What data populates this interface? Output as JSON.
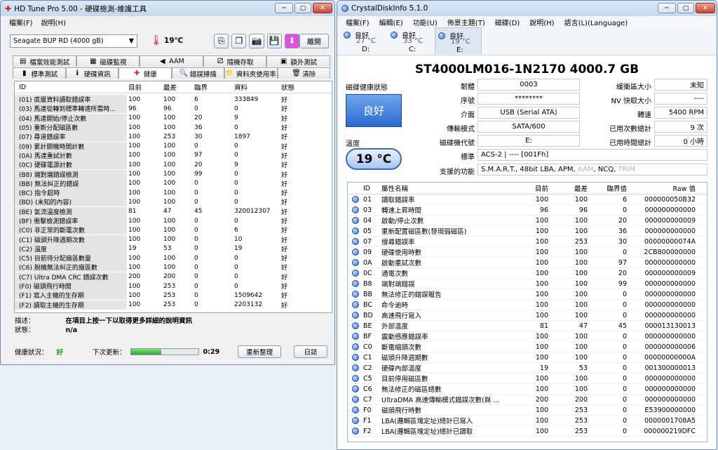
{
  "hdtune": {
    "title": "HD Tune Pro  5.00 - 硬碟檢測-維護工具",
    "menu": [
      "檔案(F)",
      "說明(H)"
    ],
    "drive": "Seagate BUP RD          (4000 gB)",
    "temp": "19℃",
    "exit_label": "離開",
    "tabs_top": [
      {
        "label": "檔案效能測試",
        "icon": "files-icon"
      },
      {
        "label": "磁碟監視",
        "icon": "monitor-icon"
      },
      {
        "label": "AAM",
        "icon": "speaker-icon"
      },
      {
        "label": "隨機存取",
        "icon": "dice-icon"
      },
      {
        "label": "額外測試",
        "icon": "extra-icon"
      }
    ],
    "tabs_bottom": [
      {
        "label": "標準測試",
        "icon": "benchmark-icon"
      },
      {
        "label": "硬碟資訊",
        "icon": "info-icon"
      },
      {
        "label": "健康",
        "icon": "health-cross-icon"
      },
      {
        "label": "錯誤掃描",
        "icon": "magnifier-icon"
      },
      {
        "label": "資料夾使用率",
        "icon": "folder-icon"
      },
      {
        "label": "清除",
        "icon": "trash-icon"
      }
    ],
    "columns": [
      "ID",
      "目前",
      "最差",
      "臨界",
      "資料",
      "狀態"
    ],
    "rows": [
      [
        "(01) 底層資料讀取錯誤率",
        "100",
        "100",
        "6",
        "333849",
        "好"
      ],
      [
        "(03) 馬達從轉到標準轉速所需時...",
        "96",
        "96",
        "0",
        "0",
        "好"
      ],
      [
        "(04) 馬達開始/停止次數",
        "100",
        "100",
        "20",
        "9",
        "好"
      ],
      [
        "(05) 重新分配磁區數",
        "100",
        "100",
        "36",
        "0",
        "好"
      ],
      [
        "(07) 尋道錯誤率",
        "100",
        "253",
        "30",
        "1897",
        "好"
      ],
      [
        "(09) 累計開機時間計數",
        "100",
        "100",
        "0",
        "0",
        "好"
      ],
      [
        "(0A) 馬達重試計數",
        "100",
        "100",
        "97",
        "0",
        "好"
      ],
      [
        "(0C) 硬碟電源計數",
        "100",
        "100",
        "20",
        "9",
        "好"
      ],
      [
        "(B8) 端對端錯誤檢測",
        "100",
        "100",
        "99",
        "0",
        "好"
      ],
      [
        "(BB) 無法糾正的錯誤",
        "100",
        "100",
        "0",
        "0",
        "好"
      ],
      [
        "(BC) 指令超時",
        "100",
        "100",
        "0",
        "0",
        "好"
      ],
      [
        "(BD) (未知的內容)",
        "100",
        "100",
        "0",
        "0",
        "好"
      ],
      [
        "(BE) 氣流溫度檢測",
        "81",
        "47",
        "45",
        "320012307",
        "好"
      ],
      [
        "(BF) 衝擊檢測錯誤率",
        "100",
        "100",
        "0",
        "0",
        "好"
      ],
      [
        "(C0) 非正常的斷電次數",
        "100",
        "100",
        "0",
        "6",
        "好"
      ],
      [
        "(C1) 磁頭升降週期次數",
        "100",
        "100",
        "0",
        "10",
        "好"
      ],
      [
        "(C2) 溫度",
        "19",
        "53",
        "0",
        "19",
        "好"
      ],
      [
        "(C5) 目前待分配扇區數量",
        "100",
        "100",
        "0",
        "0",
        "好"
      ],
      [
        "(C6) 脫機無法糾正的扇區數",
        "100",
        "100",
        "0",
        "0",
        "好"
      ],
      [
        "(C7) Ultra DMA CRC 錯誤次數",
        "200",
        "200",
        "0",
        "0",
        "好"
      ],
      [
        "(F0) 磁頭飛行時間",
        "100",
        "253",
        "0",
        "0",
        "好"
      ],
      [
        "(F1) 寫入主機的生存期",
        "100",
        "253",
        "0",
        "1509642",
        "好"
      ],
      [
        "(F2) 讀取主機的生存期",
        "100",
        "253",
        "0",
        "2203132",
        "好"
      ]
    ],
    "desc_label": "描述：",
    "desc_value": "在項目上按一下以取得更多詳細的說明資訊",
    "state_label": "狀態：",
    "state_value": "n/a",
    "health_label": "健康狀況：",
    "health_value": "好",
    "next_update_label": "下次更新：",
    "progress": 0.45,
    "time": "0:29",
    "refresh_label": "重新整理",
    "log_label": "日誌"
  },
  "cdi": {
    "title": "CrystalDiskInfo 5.1.0",
    "menu": [
      "檔案(F)",
      "編輯(E)",
      "功能(U)",
      "佈景主題(T)",
      "磁碟(D)",
      "說明(H)",
      "語言(L)(Language)"
    ],
    "disks": [
      {
        "status": "良好",
        "temp": "27 °C",
        "letter": "D:"
      },
      {
        "status": "良好",
        "temp": "33 °C",
        "letter": "C:"
      },
      {
        "status": "良好",
        "temp": "19 °C",
        "letter": "E:"
      }
    ],
    "model": "ST4000LM016-1N2170  4000.7 GB",
    "health_title": "磁碟健康狀態",
    "health": "良好",
    "temp_title": "溫度",
    "temp": "19 °C",
    "firmware_label": "韌體",
    "firmware": "0003",
    "serial_label": "序號",
    "serial": "********",
    "interface_label": "介面",
    "interface": "USB (Serial ATA)",
    "transfer_label": "傳輸模式",
    "transfer": "SATA/600",
    "letter_label": "磁碟機代號",
    "letter": "E:",
    "standard_label": "標準",
    "standard": "ACS-2 | ---- [001Fh]",
    "features_label": "支援的功能",
    "features": "S.M.A.R.T., 48bit LBA, APM,",
    "features_dim": "AAM",
    "features_mid": ", NCQ,",
    "features_dim2": "TRIM",
    "buffer_label": "緩衝區大小",
    "buffer": "未知",
    "nvcache_label": "NV 快取大小",
    "nvcache": "----",
    "rpm_label": "轉速",
    "rpm": "5400 RPM",
    "poweron_count_label": "已用次數總計",
    "poweron_count": "9 次",
    "poweron_hours_label": "已用時間總計",
    "poweron_hours": "0 小時",
    "columns": [
      "ID",
      "屬性名稱",
      "目前",
      "最差",
      "臨界值",
      "Raw 值"
    ],
    "rows": [
      [
        "01",
        "讀取錯誤率",
        "100",
        "100",
        "6",
        "000000050B32"
      ],
      [
        "03",
        "轉速上昇時間",
        "96",
        "96",
        "0",
        "000000000000"
      ],
      [
        "04",
        "啟動/停止次數",
        "100",
        "100",
        "20",
        "000000000009"
      ],
      [
        "05",
        "重新配置磁區數(發現弱磁區)",
        "100",
        "100",
        "36",
        "000000000000"
      ],
      [
        "07",
        "搜尋錯誤率",
        "100",
        "253",
        "30",
        "00000000074A"
      ],
      [
        "09",
        "硬碟使用時數",
        "100",
        "100",
        "0",
        "2CB800000000"
      ],
      [
        "0A",
        "啟動重試次數",
        "100",
        "100",
        "97",
        "000000000000"
      ],
      [
        "0C",
        "通電次數",
        "100",
        "100",
        "20",
        "000000000009"
      ],
      [
        "B8",
        "端對端錯誤",
        "100",
        "100",
        "99",
        "000000000000"
      ],
      [
        "BB",
        "無法修正的錯誤報告",
        "100",
        "100",
        "0",
        "000000000000"
      ],
      [
        "BC",
        "命令逾時",
        "100",
        "100",
        "0",
        "000000000000"
      ],
      [
        "BD",
        "高速飛行寫入",
        "100",
        "100",
        "0",
        "000000000000"
      ],
      [
        "BE",
        "外部溫度",
        "81",
        "47",
        "45",
        "000013130013"
      ],
      [
        "BF",
        "震動感應錯誤率",
        "100",
        "100",
        "0",
        "000000000000"
      ],
      [
        "C0",
        "斷電縮頭次數",
        "100",
        "100",
        "0",
        "000000000006"
      ],
      [
        "C1",
        "磁頭升降週期數",
        "100",
        "100",
        "0",
        "00000000000A"
      ],
      [
        "C2",
        "硬碟內部溫度",
        "19",
        "53",
        "0",
        "001300000013"
      ],
      [
        "C5",
        "目前停用磁區數",
        "100",
        "100",
        "0",
        "000000000000"
      ],
      [
        "C6",
        "無法修正的磁區總數",
        "100",
        "100",
        "0",
        "000000000000"
      ],
      [
        "C7",
        "UltraDMA 高速傳輸模式錯誤次數(與 ...",
        "200",
        "200",
        "0",
        "000000000000"
      ],
      [
        "F0",
        "磁頭飛行時數",
        "100",
        "253",
        "0",
        "E53900000000"
      ],
      [
        "F1",
        "LBA(邏輯區塊定址)總計已寫入",
        "100",
        "253",
        "0",
        "0000001708A5"
      ],
      [
        "F2",
        "LBA(邏輯區塊定址)總計已讀取",
        "100",
        "253",
        "0",
        "000000219DFC"
      ]
    ]
  }
}
